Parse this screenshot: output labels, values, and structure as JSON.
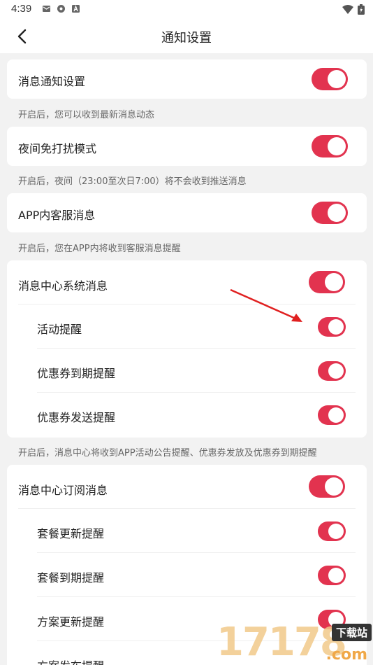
{
  "status_bar": {
    "time": "4:39"
  },
  "header": {
    "title": "通知设置"
  },
  "sections": [
    {
      "main": {
        "label": "消息通知设置",
        "on": true
      },
      "hint": "开启后，您可以收到最新消息动态"
    },
    {
      "main": {
        "label": "夜间免打扰模式",
        "on": true
      },
      "hint": "开启后，夜间（23:00至次日7:00）将不会收到推送消息"
    },
    {
      "main": {
        "label": "APP内客服消息",
        "on": true
      },
      "hint": "开启后，您在APP内将收到客服消息提醒"
    },
    {
      "main": {
        "label": "消息中心系统消息",
        "on": true
      },
      "subs": [
        {
          "label": "活动提醒",
          "on": true
        },
        {
          "label": "优惠券到期提醒",
          "on": true
        },
        {
          "label": "优惠券发送提醒",
          "on": true
        }
      ],
      "hint": "开启后，消息中心将收到APP活动公告提醒、优惠券发放及优惠券到期提醒"
    },
    {
      "main": {
        "label": "消息中心订阅消息",
        "on": true
      },
      "subs": [
        {
          "label": "套餐更新提醒",
          "on": true
        },
        {
          "label": "套餐到期提醒",
          "on": true
        },
        {
          "label": "方案更新提醒",
          "on": true
        },
        {
          "label": "方案发布提醒",
          "on": true
        }
      ]
    }
  ],
  "watermark": {
    "digits": "17178",
    "badge": "下载站",
    "suffix": ".com"
  },
  "colors": {
    "accent": "#e2334f",
    "background": "#f2f2f2",
    "card": "#ffffff",
    "hint": "#666666"
  }
}
